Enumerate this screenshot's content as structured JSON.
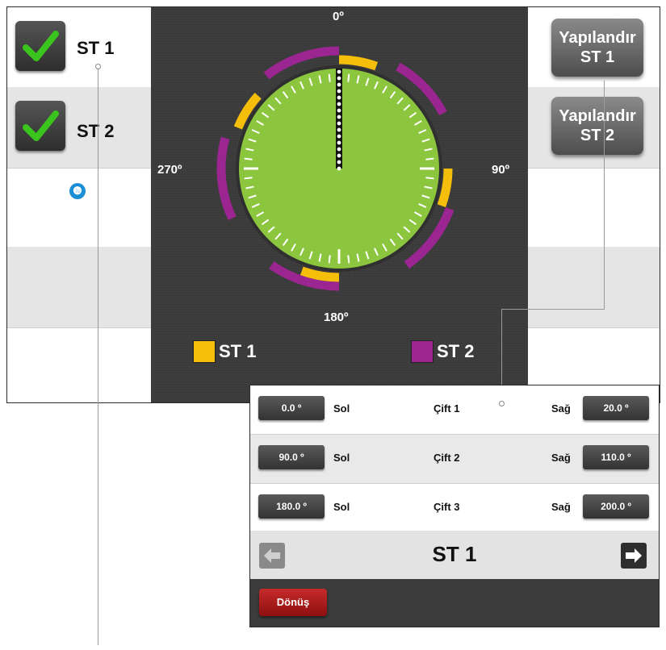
{
  "stations": [
    {
      "label": "ST 1",
      "checked": true
    },
    {
      "label": "ST 2",
      "checked": true
    }
  ],
  "callout_badge": "❿",
  "dial": {
    "deg_0": "0º",
    "deg_90": "90º",
    "deg_180": "180º",
    "deg_270": "270º",
    "face_color": "#8cc63f",
    "st1_color": "#f5be0b",
    "st2_color": "#9b2591"
  },
  "configure_buttons": [
    {
      "line1": "Yapılandır",
      "line2": "ST 1"
    },
    {
      "line1": "Yapılandır",
      "line2": "ST 2"
    }
  ],
  "legend": [
    {
      "label": "ST 1",
      "color": "#f5be0b"
    },
    {
      "label": "ST 2",
      "color": "#9b2591"
    }
  ],
  "popup": {
    "rows": [
      {
        "left_value": "0.0 º",
        "left_label": "Sol",
        "pair": "Çift 1",
        "right_label": "Sağ",
        "right_value": "20.0 º"
      },
      {
        "left_value": "90.0 º",
        "left_label": "Sol",
        "pair": "Çift 2",
        "right_label": "Sağ",
        "right_value": "110.0 º"
      },
      {
        "left_value": "180.0 º",
        "left_label": "Sol",
        "pair": "Çift 3",
        "right_label": "Sağ",
        "right_value": "200.0 º"
      }
    ],
    "nav_title": "ST 1",
    "back_label": "Dönüş"
  }
}
